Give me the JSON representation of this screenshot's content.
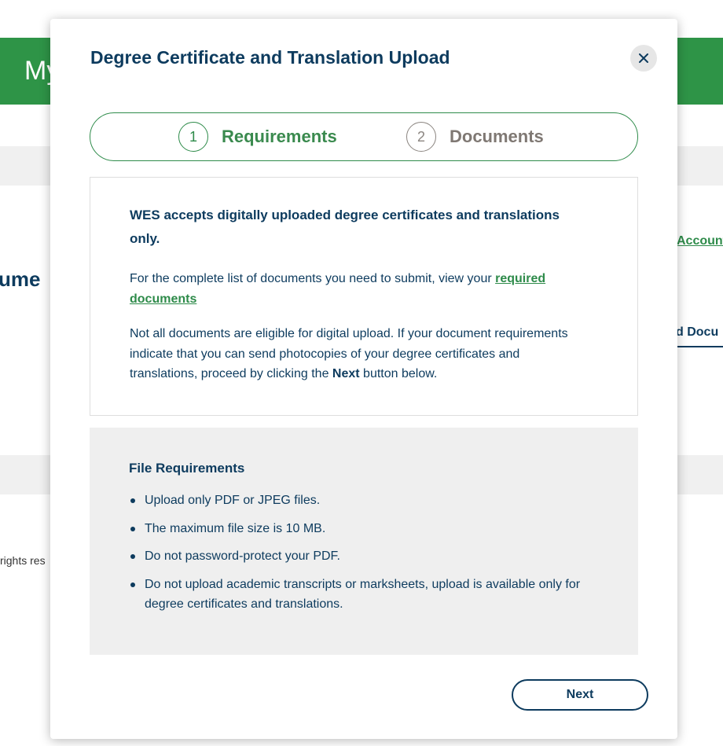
{
  "background": {
    "header_title": "My",
    "heading_fragment": "ume",
    "account_link_fragment": "Account",
    "upload_button_fragment": "d Docu",
    "footer_fragment": "rights res"
  },
  "modal": {
    "title": "Degree Certificate and Translation Upload",
    "close_icon": "close-icon",
    "steps": [
      {
        "number": "1",
        "label": "Requirements",
        "state": "active"
      },
      {
        "number": "2",
        "label": "Documents",
        "state": "inactive"
      }
    ],
    "info": {
      "heading": "WES accepts digitally uploaded degree certificates and translations only.",
      "paragraph1_text": "For the complete list of documents you need to submit, view your ",
      "paragraph1_link": "required documents",
      "paragraph2_before": "Not all documents are eligible for digital upload. If your document requirements indicate that you can send photocopies of your degree certificates and translations, proceed by clicking the ",
      "paragraph2_bold": "Next",
      "paragraph2_after": " button below."
    },
    "file_requirements": {
      "title": "File Requirements",
      "items": [
        "Upload only PDF or JPEG files.",
        "The maximum file size is 10 MB.",
        "Do not password-protect your PDF.",
        "Do not upload academic transcripts or marksheets, upload is available only for degree certificates and translations."
      ]
    },
    "next_label": "Next"
  },
  "colors": {
    "brand_green": "#2e9447",
    "link_green": "#2e8b4a",
    "navy": "#0d3b5e",
    "inactive_gray": "#7f7873",
    "panel_gray": "#efefef"
  }
}
